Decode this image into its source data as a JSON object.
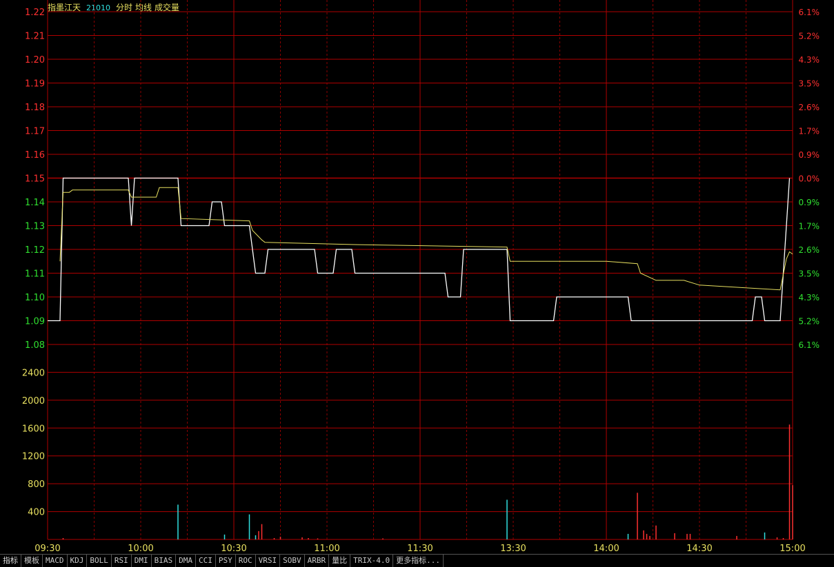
{
  "header": {
    "stock_name": "指墨江天",
    "code": "21010",
    "labels": [
      "分时",
      "均线",
      "成交量"
    ]
  },
  "colors": {
    "grid": "#b00000",
    "axis_up": "#ff3030",
    "axis_down": "#30e030",
    "axis_vol": "#e8e060",
    "price_line": "#ffffff",
    "avg_line": "#e8e060",
    "vol_up": "#ff3030",
    "vol_down": "#30e0e0",
    "header_name": "#e8e060",
    "header_code": "#30e0e0",
    "header_label": "#e8e060"
  },
  "tabs": [
    "指标",
    "模板",
    "MACD",
    "KDJ",
    "BOLL",
    "RSI",
    "DMI",
    "BIAS",
    "DMA",
    "CCI",
    "PSY",
    "ROC",
    "VRSI",
    "SOBV",
    "ARBR",
    "量比",
    "TRIX-4.0",
    "更多指标..."
  ],
  "chart_data": {
    "type": "line",
    "price_axis": {
      "ticks": [
        "1.22",
        "1.21",
        "1.20",
        "1.19",
        "1.18",
        "1.17",
        "1.16",
        "1.15",
        "1.14",
        "1.13",
        "1.12",
        "1.11",
        "1.10",
        "1.09",
        "1.08"
      ],
      "pct_ticks": [
        "6.1%",
        "5.2%",
        "4.3%",
        "3.5%",
        "2.6%",
        "1.7%",
        "0.9%",
        "0.0%",
        "0.9%",
        "1.7%",
        "2.6%",
        "3.5%",
        "4.3%",
        "5.2%",
        "6.1%"
      ],
      "ylim": [
        1.08,
        1.22
      ],
      "prev_close": 1.15
    },
    "volume_axis": {
      "ticks": [
        "2400",
        "2000",
        "1600",
        "1200",
        "800",
        "400"
      ],
      "ylim": [
        0,
        2800
      ]
    },
    "x_ticks": [
      "09:30",
      "10:00",
      "10:30",
      "11:00",
      "11:30",
      "13:30",
      "14:00",
      "14:30",
      "15:00"
    ],
    "x_range_minutes": [
      0,
      240
    ],
    "series": [
      {
        "key": "price",
        "points": [
          [
            0,
            1.09
          ],
          [
            4,
            1.09
          ],
          [
            5,
            1.15
          ],
          [
            26,
            1.15
          ],
          [
            27,
            1.13
          ],
          [
            28,
            1.15
          ],
          [
            42,
            1.15
          ],
          [
            43,
            1.13
          ],
          [
            52,
            1.13
          ],
          [
            53,
            1.14
          ],
          [
            56,
            1.14
          ],
          [
            57,
            1.13
          ],
          [
            65,
            1.13
          ],
          [
            66,
            1.12
          ],
          [
            67,
            1.11
          ],
          [
            70,
            1.11
          ],
          [
            71,
            1.12
          ],
          [
            86,
            1.12
          ],
          [
            87,
            1.11
          ],
          [
            92,
            1.11
          ],
          [
            93,
            1.12
          ],
          [
            98,
            1.12
          ],
          [
            99,
            1.11
          ],
          [
            128,
            1.11
          ],
          [
            129,
            1.1
          ],
          [
            133,
            1.1
          ],
          [
            134,
            1.12
          ],
          [
            148,
            1.12
          ],
          [
            149,
            1.09
          ],
          [
            163,
            1.09
          ],
          [
            164,
            1.1
          ],
          [
            187,
            1.1
          ],
          [
            188,
            1.09
          ],
          [
            227,
            1.09
          ],
          [
            228,
            1.1
          ],
          [
            230,
            1.1
          ],
          [
            231,
            1.09
          ],
          [
            236,
            1.09
          ],
          [
            239,
            1.15
          ]
        ]
      },
      {
        "key": "avg",
        "points": [
          [
            4,
            1.115
          ],
          [
            5,
            1.144
          ],
          [
            7,
            1.144
          ],
          [
            8,
            1.145
          ],
          [
            26,
            1.145
          ],
          [
            27,
            1.142
          ],
          [
            35,
            1.142
          ],
          [
            36,
            1.146
          ],
          [
            42,
            1.146
          ],
          [
            43,
            1.133
          ],
          [
            65,
            1.132
          ],
          [
            66,
            1.128
          ],
          [
            69,
            1.124
          ],
          [
            70,
            1.123
          ],
          [
            100,
            1.122
          ],
          [
            148,
            1.121
          ],
          [
            149,
            1.115
          ],
          [
            180,
            1.115
          ],
          [
            190,
            1.114
          ],
          [
            191,
            1.11
          ],
          [
            196,
            1.107
          ],
          [
            205,
            1.107
          ],
          [
            210,
            1.105
          ],
          [
            236,
            1.103
          ],
          [
            238,
            1.116
          ],
          [
            239,
            1.119
          ],
          [
            240,
            1.118
          ]
        ]
      }
    ],
    "volume": [
      {
        "t": 5,
        "v": 20,
        "dir": "up"
      },
      {
        "t": 42,
        "v": 500,
        "dir": "down"
      },
      {
        "t": 57,
        "v": 70,
        "dir": "down"
      },
      {
        "t": 65,
        "v": 360,
        "dir": "down"
      },
      {
        "t": 67,
        "v": 60,
        "dir": "down"
      },
      {
        "t": 68,
        "v": 120,
        "dir": "up"
      },
      {
        "t": 69,
        "v": 220,
        "dir": "up"
      },
      {
        "t": 73,
        "v": 20,
        "dir": "up"
      },
      {
        "t": 75,
        "v": 40,
        "dir": "up"
      },
      {
        "t": 82,
        "v": 30,
        "dir": "up"
      },
      {
        "t": 84,
        "v": 20,
        "dir": "up"
      },
      {
        "t": 87,
        "v": 15,
        "dir": "up"
      },
      {
        "t": 108,
        "v": 15,
        "dir": "up"
      },
      {
        "t": 148,
        "v": 570,
        "dir": "down"
      },
      {
        "t": 187,
        "v": 80,
        "dir": "down"
      },
      {
        "t": 190,
        "v": 670,
        "dir": "up"
      },
      {
        "t": 192,
        "v": 130,
        "dir": "up"
      },
      {
        "t": 193,
        "v": 80,
        "dir": "up"
      },
      {
        "t": 194,
        "v": 50,
        "dir": "up"
      },
      {
        "t": 196,
        "v": 200,
        "dir": "up"
      },
      {
        "t": 202,
        "v": 90,
        "dir": "up"
      },
      {
        "t": 206,
        "v": 80,
        "dir": "up"
      },
      {
        "t": 207,
        "v": 80,
        "dir": "up"
      },
      {
        "t": 222,
        "v": 50,
        "dir": "up"
      },
      {
        "t": 231,
        "v": 100,
        "dir": "down"
      },
      {
        "t": 235,
        "v": 30,
        "dir": "up"
      },
      {
        "t": 237,
        "v": 20,
        "dir": "up"
      },
      {
        "t": 239,
        "v": 1650,
        "dir": "up"
      },
      {
        "t": 240,
        "v": 780,
        "dir": "up"
      }
    ]
  }
}
